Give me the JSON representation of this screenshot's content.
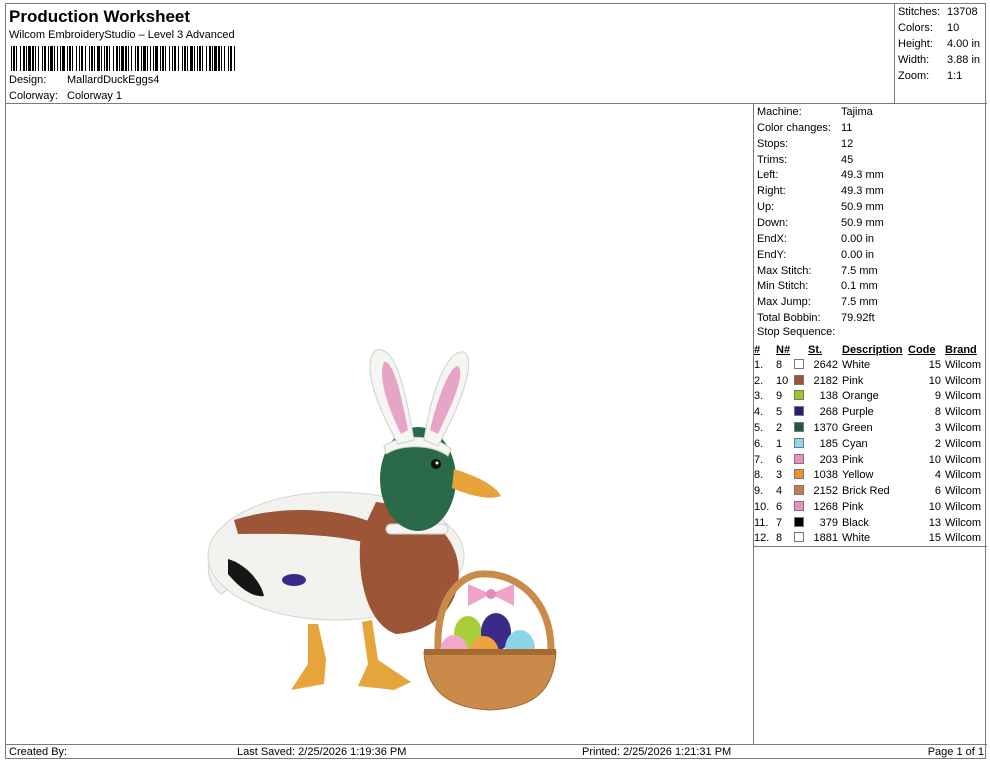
{
  "header": {
    "title": "Production Worksheet",
    "software": "Wilcom EmbroideryStudio – Level 3 Advanced",
    "design_label": "Design:",
    "design_value": "MallardDuckEggs4",
    "colorway_label": "Colorway:",
    "colorway_value": "Colorway 1"
  },
  "summary": [
    {
      "label": "Stitches:",
      "value": "13708"
    },
    {
      "label": "Colors:",
      "value": "10"
    },
    {
      "label": "Height:",
      "value": "4.00 in"
    },
    {
      "label": "Width:",
      "value": "3.88 in"
    },
    {
      "label": "Zoom:",
      "value": "1:1"
    }
  ],
  "specs": [
    {
      "label": "Machine:",
      "value": "Tajima"
    },
    {
      "label": "Color changes:",
      "value": "11"
    },
    {
      "label": "Stops:",
      "value": "12"
    },
    {
      "label": "Trims:",
      "value": "45"
    },
    {
      "label": "Left:",
      "value": "49.3 mm"
    },
    {
      "label": "Right:",
      "value": "49.3 mm"
    },
    {
      "label": "Up:",
      "value": "50.9 mm"
    },
    {
      "label": "Down:",
      "value": "50.9 mm"
    },
    {
      "label": "EndX:",
      "value": "0.00 in"
    },
    {
      "label": "EndY:",
      "value": "0.00 in"
    },
    {
      "label": "Max Stitch:",
      "value": "7.5 mm"
    },
    {
      "label": "Min Stitch:",
      "value": "0.1 mm"
    },
    {
      "label": "Max Jump:",
      "value": "7.5 mm"
    },
    {
      "label": "Total Bobbin:",
      "value": "79.92ft"
    }
  ],
  "stop_sequence": {
    "title": "Stop Sequence:",
    "headers": {
      "num": "#",
      "n": "N#",
      "st": "St.",
      "description": "Description",
      "code": "Code",
      "brand": "Brand"
    },
    "rows": [
      {
        "num": "1.",
        "n": "8",
        "color": "#ffffff",
        "st": "2642",
        "description": "White",
        "code": "15",
        "brand": "Wilcom"
      },
      {
        "num": "2.",
        "n": "10",
        "color": "#a0523c",
        "st": "2182",
        "description": "Pink",
        "code": "10",
        "brand": "Wilcom"
      },
      {
        "num": "3.",
        "n": "9",
        "color": "#9cc81e",
        "st": "138",
        "description": "Orange",
        "code": "9",
        "brand": "Wilcom"
      },
      {
        "num": "4.",
        "n": "5",
        "color": "#2d1a78",
        "st": "268",
        "description": "Purple",
        "code": "8",
        "brand": "Wilcom"
      },
      {
        "num": "5.",
        "n": "2",
        "color": "#1f5a3e",
        "st": "1370",
        "description": "Green",
        "code": "3",
        "brand": "Wilcom"
      },
      {
        "num": "6.",
        "n": "1",
        "color": "#8fd8ec",
        "st": "185",
        "description": "Cyan",
        "code": "2",
        "brand": "Wilcom"
      },
      {
        "num": "7.",
        "n": "6",
        "color": "#f08cc0",
        "st": "203",
        "description": "Pink",
        "code": "10",
        "brand": "Wilcom"
      },
      {
        "num": "8.",
        "n": "3",
        "color": "#f0922a",
        "st": "1038",
        "description": "Yellow",
        "code": "4",
        "brand": "Wilcom"
      },
      {
        "num": "9.",
        "n": "4",
        "color": "#c87a4a",
        "st": "2152",
        "description": "Brick Red",
        "code": "6",
        "brand": "Wilcom"
      },
      {
        "num": "10.",
        "n": "6",
        "color": "#f08cc0",
        "st": "1268",
        "description": "Pink",
        "code": "10",
        "brand": "Wilcom"
      },
      {
        "num": "11.",
        "n": "7",
        "color": "#000000",
        "st": "379",
        "description": "Black",
        "code": "13",
        "brand": "Wilcom"
      },
      {
        "num": "12.",
        "n": "8",
        "color": "#ffffff",
        "st": "1881",
        "description": "White",
        "code": "15",
        "brand": "Wilcom"
      }
    ]
  },
  "footer": {
    "created_by": "Created By:",
    "last_saved": "Last Saved: 2/25/2026 1:19:36 PM",
    "printed": "Printed: 2/25/2026 1:21:31 PM",
    "page": "Page 1 of 1"
  }
}
